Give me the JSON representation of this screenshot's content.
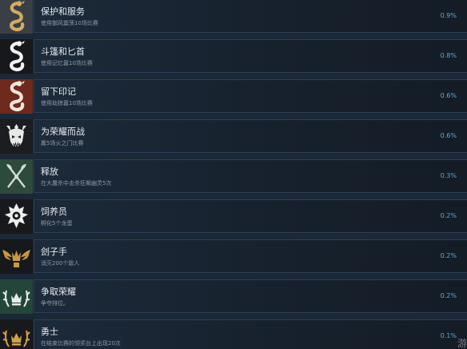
{
  "achievements": [
    {
      "title": "保护和服务",
      "desc": "使用御风震荡10场比赛",
      "percent": "0.9%",
      "icon": "serpent-icon",
      "icon_color": "#d3ab62",
      "icon_bg": "#3a3f46"
    },
    {
      "title": "斗篷和匕首",
      "desc": "使用记忆嚣10场比赛",
      "percent": "0.8%",
      "icon": "serpent-icon",
      "icon_color": "#f2f2f2",
      "icon_bg": "#16181b"
    },
    {
      "title": "留下印记",
      "desc": "使用劫掠嚣10场比赛",
      "percent": "0.6%",
      "icon": "serpent-icon",
      "icon_color": "#f4e6dc",
      "icon_bg": "#6e2a1c"
    },
    {
      "title": "为荣耀而战",
      "desc": "赢5场火之门比赛",
      "percent": "0.6%",
      "icon": "demon-skull-icon",
      "icon_color": "#e8e8e8",
      "icon_bg": "#1c1d20"
    },
    {
      "title": "释放",
      "desc": "在大屠杀中击杀狂飙幽灵5次",
      "percent": "0.3%",
      "icon": "crossed-axes-icon",
      "icon_color": "#d0dcd4",
      "icon_bg": "#2e4a3c"
    },
    {
      "title": "饲养员",
      "desc": "孵化5个龙蛋",
      "percent": "0.2%",
      "icon": "horned-emblem-icon",
      "icon_color": "#eeeeee",
      "icon_bg": "#18191c"
    },
    {
      "title": "刽子手",
      "desc": "消灭200个敌人",
      "percent": "0.2%",
      "icon": "winged-crown-icon",
      "icon_color": "#c99a3c",
      "icon_bg": "#16181c"
    },
    {
      "title": "争取荣耀",
      "desc": "争夺排位。",
      "percent": "0.2%",
      "icon": "antler-crown-icon",
      "icon_color": "#e4ece6",
      "icon_bg": "#24453a"
    },
    {
      "title": "勇士",
      "desc": "在结束比赛的领奖台上出现20次",
      "percent": "0.1%",
      "icon": "antler-crown-icon",
      "icon_color": "#d2a246",
      "icon_bg": "#17191c"
    }
  ],
  "watermark": "游"
}
